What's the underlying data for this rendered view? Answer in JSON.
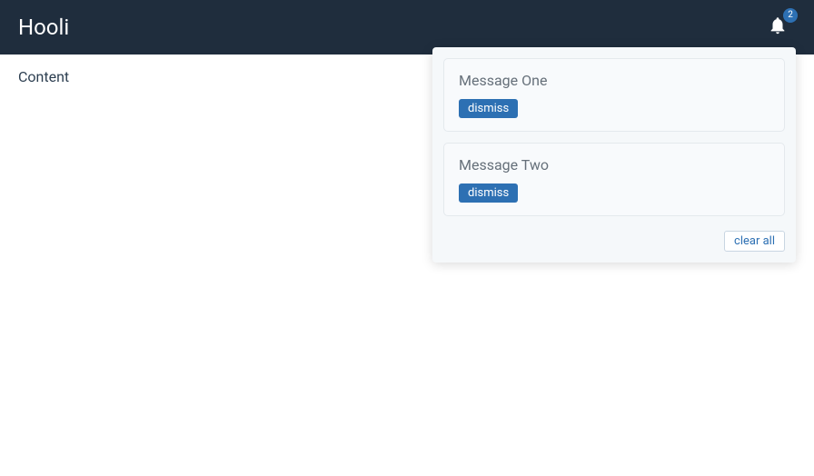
{
  "header": {
    "title": "Hooli",
    "notification_count": "2"
  },
  "main": {
    "content_text": "Content"
  },
  "dropdown": {
    "messages": [
      {
        "title": "Message One",
        "dismiss_label": "dismiss"
      },
      {
        "title": "Message Two",
        "dismiss_label": "dismiss"
      }
    ],
    "clear_all_label": "clear all"
  }
}
